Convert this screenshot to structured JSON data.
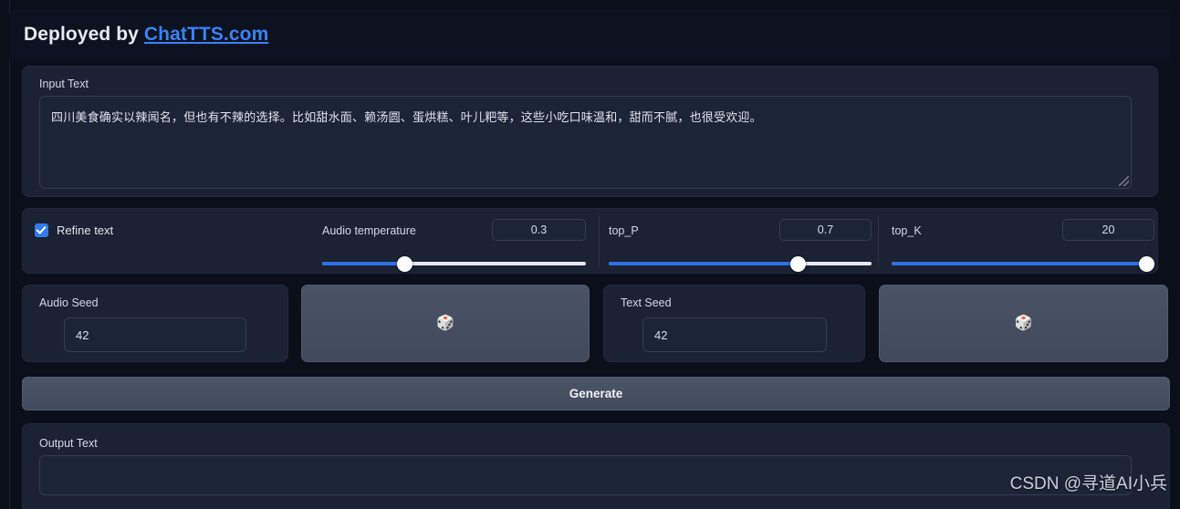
{
  "header": {
    "prefix": "Deployed by ",
    "link_text": "ChatTTS.com",
    "link_color": "#3b82f6"
  },
  "input_section": {
    "label": "Input Text",
    "value": "四川美食确实以辣闻名，但也有不辣的选择。比如甜水面、赖汤圆、蛋烘糕、叶儿粑等，这些小吃口味温和，甜而不腻，也很受欢迎。",
    "resize_handle_icon": "resize-grip-icon"
  },
  "controls": {
    "refine_text": {
      "label": "Refine text",
      "checked": true,
      "checkbox_color": "#2f7ced"
    },
    "sliders": [
      {
        "name": "audio_temperature",
        "label": "Audio temperature",
        "value": "0.3",
        "fill_percent": 31
      },
      {
        "name": "top_p",
        "label": "top_P",
        "value": "0.7",
        "fill_percent": 72
      },
      {
        "name": "top_k",
        "label": "top_K",
        "value": "20",
        "fill_percent": 97
      }
    ],
    "track_fill_color": "#2f6fe4",
    "track_color": "#e7e9ee"
  },
  "seeds": {
    "audio_seed": {
      "label": "Audio Seed",
      "value": "42"
    },
    "text_seed": {
      "label": "Text Seed",
      "value": "42"
    },
    "dice_icon": "🎲",
    "dice_icon_name": "dice-icon"
  },
  "generate": {
    "label": "Generate"
  },
  "output_section": {
    "label": "Output Text",
    "value": ""
  },
  "watermark": {
    "text": "CSDN @寻道AI小兵"
  }
}
